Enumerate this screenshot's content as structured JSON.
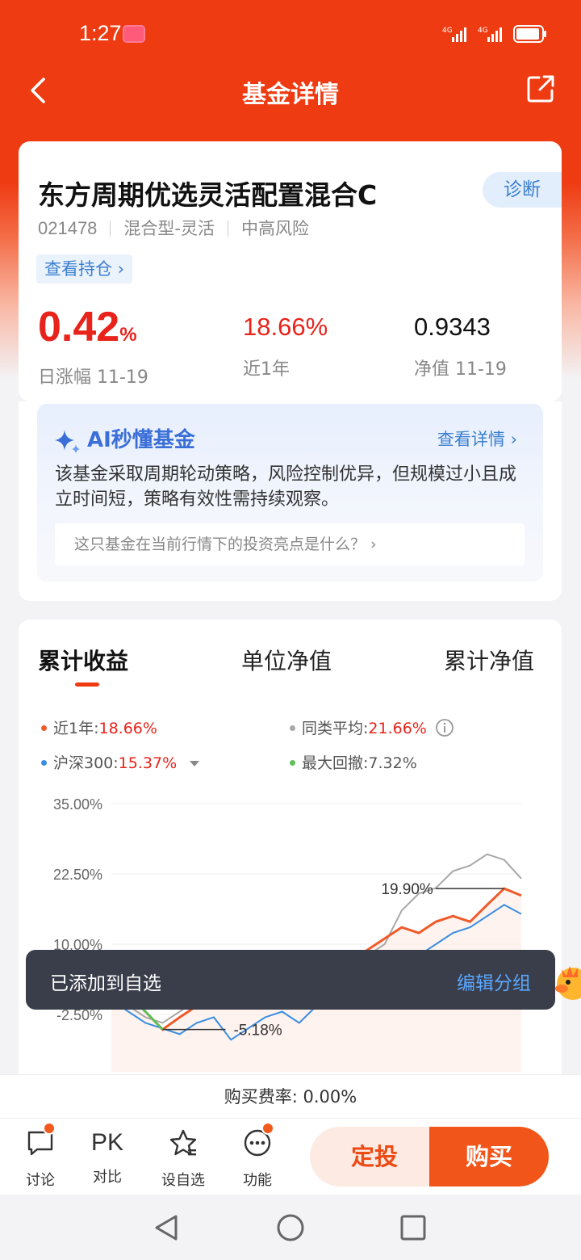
{
  "status_bar": {
    "time": "1:27",
    "signal1": "4G",
    "signal2": "4G"
  },
  "nav": {
    "title": "基金详情"
  },
  "fund": {
    "name": "东方周期优选灵活配置混合C",
    "code": "021478",
    "type": "混合型-灵活",
    "risk": "中高风险",
    "diagnose_label": "诊断",
    "holdings_link": "查看持仓 ›",
    "daily_change": "0.42",
    "daily_change_unit": "%",
    "daily_change_label": "日涨幅 11-19",
    "year_return": "18.66%",
    "year_return_label": "近1年",
    "nav_value": "0.9343",
    "nav_label": "净值 11-19"
  },
  "ai": {
    "title": "AI秒懂基金",
    "more_label": "查看详情 ›",
    "summary": "该基金采取周期轮动策略，风险控制优异，但规模过小且成立时间短，策略有效性需持续观察。",
    "question": "这只基金在当前行情下的投资亮点是什么？ ›"
  },
  "chart_section": {
    "tabs": [
      "累计收益",
      "单位净值",
      "累计净值"
    ],
    "active_tab": 0,
    "legend": {
      "fund_label": "近1年:",
      "fund_value": "18.66%",
      "avg_label": "同类平均:",
      "avg_value": "21.66%",
      "index_label": "沪深300:",
      "index_value": "15.37%",
      "drawdown_label": "最大回撤:",
      "drawdown_value": "7.32%"
    },
    "colors": {
      "fund": "#ef5a2a",
      "avg": "#a8a8a8",
      "index": "#3a8de0",
      "drawdown": "#5fbf5a"
    }
  },
  "chart_data": {
    "type": "line",
    "y_ticks": [
      "35.00%",
      "22.50%",
      "10.00%",
      "-2.50%"
    ],
    "ylim": [
      -10,
      35
    ],
    "annotations": {
      "max": "19.90%",
      "min": "-5.18%"
    },
    "x": [
      0,
      1,
      2,
      3,
      4,
      5,
      6,
      7,
      8,
      9,
      10,
      11,
      12,
      13,
      14,
      15,
      16,
      17,
      18,
      19,
      20,
      21,
      22,
      23,
      24
    ],
    "series": [
      {
        "name": "近1年",
        "values": [
          0,
          1,
          -2,
          -5.18,
          -3,
          -1,
          2,
          0,
          1,
          3,
          5,
          2,
          4,
          6,
          7,
          9,
          11,
          13,
          12,
          14,
          15,
          14,
          17,
          19.9,
          18.66
        ]
      },
      {
        "name": "同类平均",
        "values": [
          0,
          -1,
          -3,
          -4,
          -2,
          0,
          1,
          -1,
          0,
          2,
          3,
          1,
          3,
          5,
          6,
          8,
          10,
          16,
          19,
          20,
          23,
          24,
          26,
          25,
          21.66
        ]
      },
      {
        "name": "沪深300",
        "values": [
          0,
          -2,
          -4,
          -5,
          -6,
          -4,
          -3,
          -7,
          -5,
          -3,
          -2,
          -4,
          -1,
          0,
          1,
          2,
          4,
          6,
          8,
          10,
          12,
          13,
          15,
          17,
          15.37
        ]
      }
    ]
  },
  "toast": {
    "text": "已添加到自选",
    "action": "编辑分组"
  },
  "fee": {
    "text": "购买费率: 0.00%"
  },
  "bottom_bar": {
    "discuss": "讨论",
    "pk_icon_text": "PK",
    "compare": "对比",
    "watchlist": "设自选",
    "functions": "功能",
    "auto_invest": "定投",
    "buy": "购买"
  }
}
